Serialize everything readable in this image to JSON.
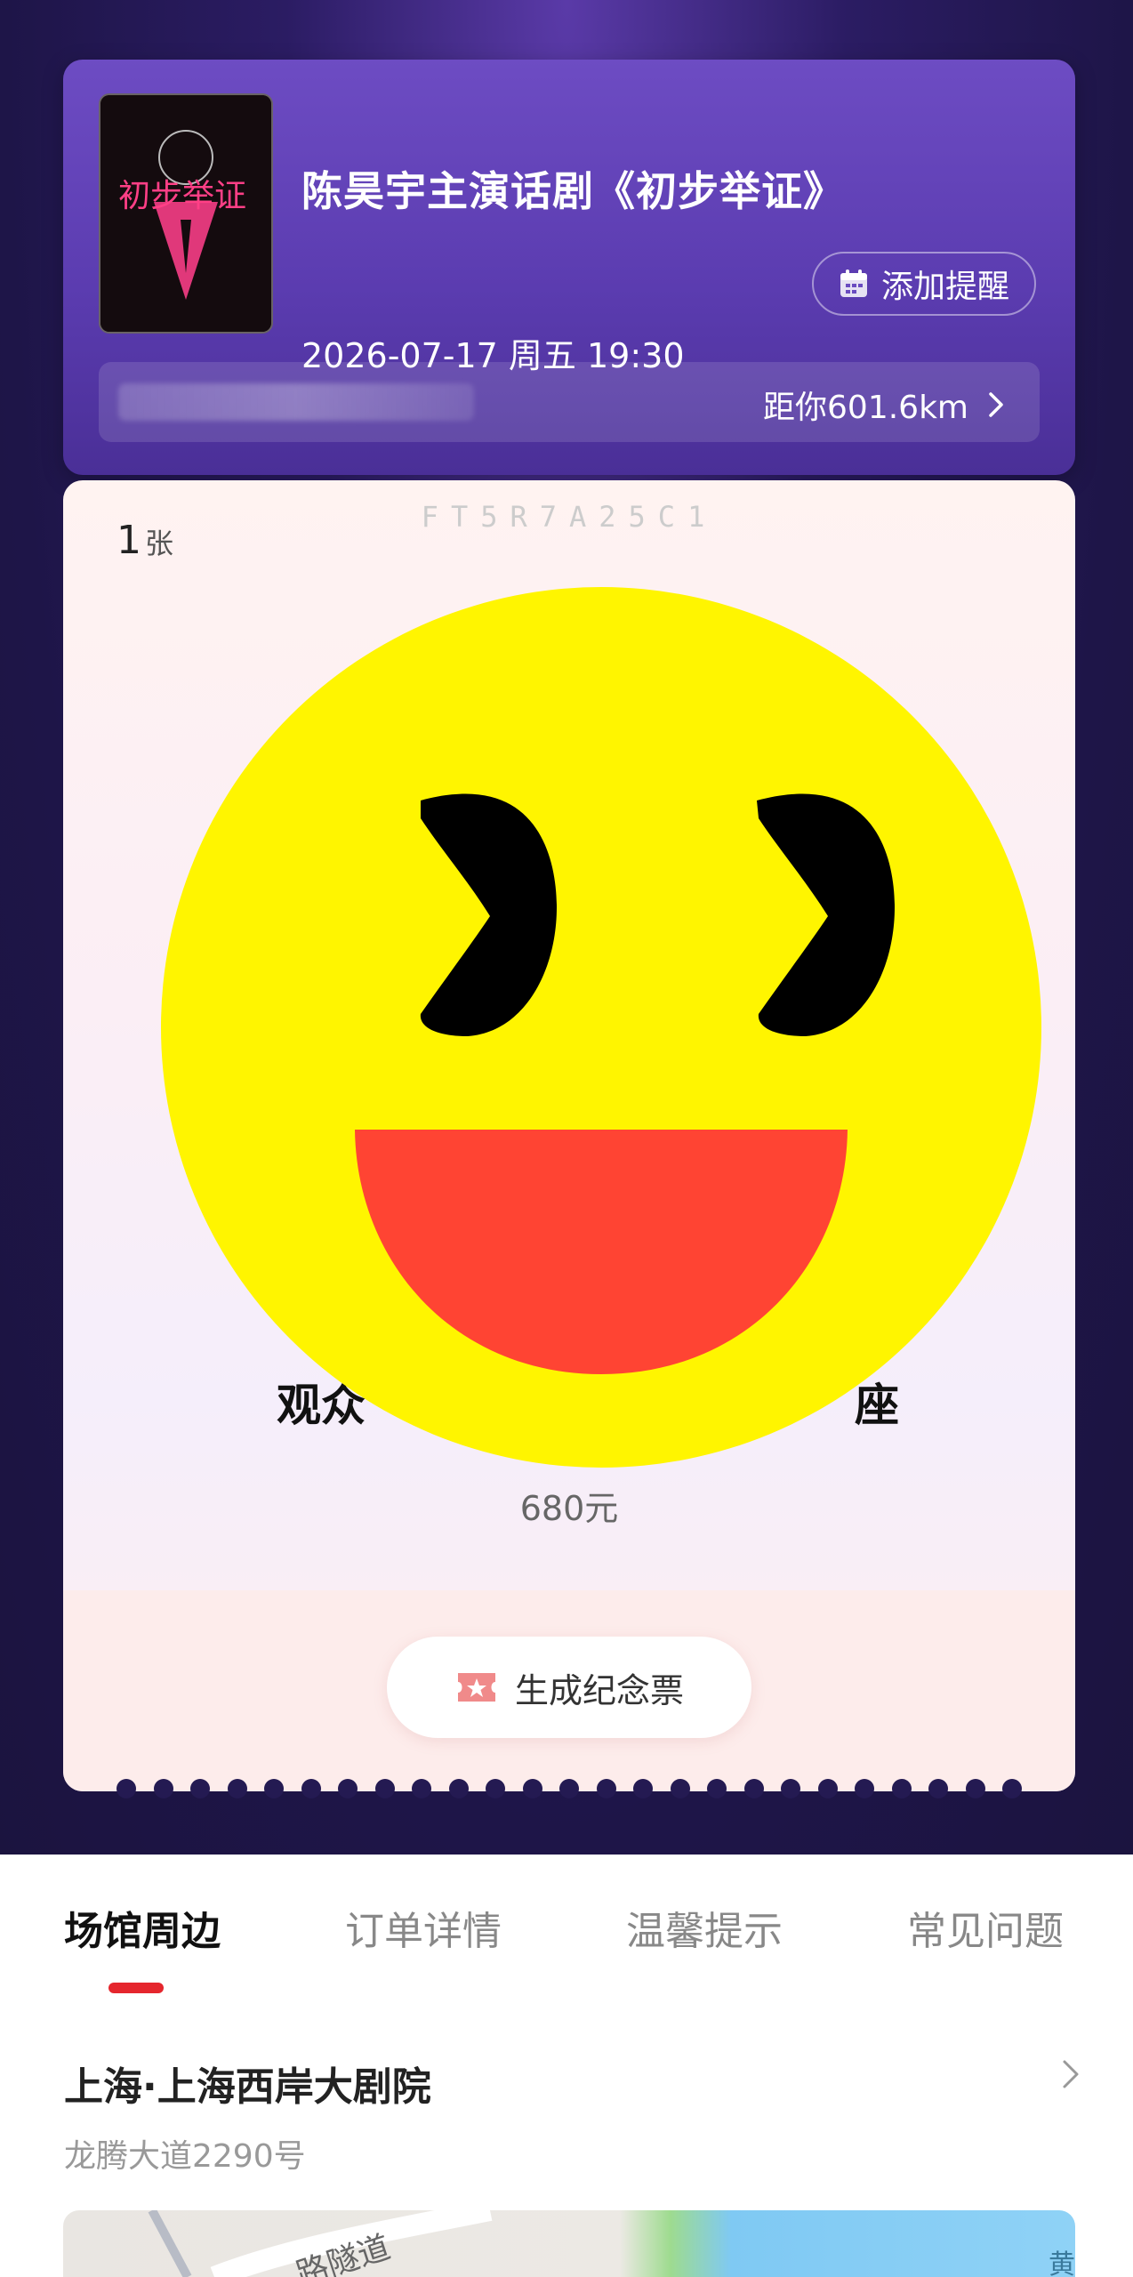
{
  "show": {
    "title": "陈昊宇主演话剧《初步举证》",
    "datetime": "2026-07-17 周五 19:30",
    "remind_label": "添加提醒",
    "distance": "距你601.6km",
    "poster_text": "初步举证"
  },
  "ticket": {
    "code": "FT5R7A25C1",
    "quantity": "1",
    "quantity_unit": "张",
    "seat_prefix": "观众",
    "seat_suffix": "座",
    "price": "680元",
    "souvenir_label": "生成纪念票"
  },
  "tabs": [
    {
      "label": "场馆周边",
      "active": true
    },
    {
      "label": "订单详情",
      "active": false
    },
    {
      "label": "温馨提示",
      "active": false
    },
    {
      "label": "常见问题",
      "active": false
    }
  ],
  "venue": {
    "name": "上海·上海西岸大剧院",
    "address": "龙腾大道2290号"
  },
  "map": {
    "road_label": "路隧道",
    "corner_label": "黄"
  },
  "colors": {
    "accent_red": "#e5262d",
    "card_purple": "#5b3cb0",
    "smiley_yellow": "#fff500",
    "mouth_red": "#ff4433"
  },
  "icons": [
    "calendar-icon",
    "chevron-right-icon",
    "ticket-icon",
    "smiley-emoji-icon"
  ]
}
